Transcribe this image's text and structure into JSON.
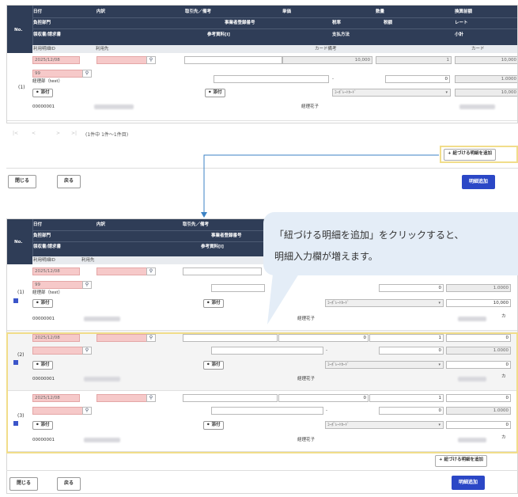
{
  "header": {
    "no": "No.",
    "row1": [
      "日付",
      "内訳",
      "取引先／備考",
      "単価",
      "数量",
      "換算前額"
    ],
    "row2": [
      "負担部門",
      "事業者登録番号",
      "税率",
      "税額",
      "レート"
    ],
    "row3": [
      "領収書/請求書",
      "参考資料[i]",
      "支払方法",
      "小計"
    ],
    "sub": [
      "利用明細ID",
      "利用先",
      "カード備考",
      "カード"
    ]
  },
  "record": {
    "date": "2025/12/08",
    "dept_code": "99",
    "dept_name": "経理部（test）",
    "attach": "添付",
    "payment": "ｺｰﾎﾟﾚｰﾄｶｰﾄﾞ",
    "detail_id": "00000001",
    "approver": "経理花子",
    "dash": "-",
    "card_suffix": "カ"
  },
  "top": {
    "row_label": "(1)",
    "unit_price": "10,000",
    "quantity": "1",
    "amount": "10,000",
    "tax": "0",
    "rate": "1.0000",
    "subtotal": "10,000",
    "pagination_first": "|<",
    "pagination_prev": "<",
    "pagination_next": ">",
    "pagination_last": ">|",
    "pagination_info": "(1件中 1件～1件目)"
  },
  "bottom_rows": [
    {
      "label": "(1)",
      "tax": "0",
      "rate": "1.0000",
      "subtotal": "10,000"
    },
    {
      "label": "(2)",
      "unit_price": "0",
      "quantity": "1",
      "amount": "0",
      "tax": "0",
      "rate": "1.0000",
      "subtotal": "0"
    },
    {
      "label": "(3)",
      "unit_price": "0",
      "quantity": "1",
      "amount": "0",
      "tax": "0",
      "rate": "1.0000",
      "subtotal": "0"
    }
  ],
  "buttons": {
    "add_detail": "紐づける明細を追加",
    "close": "閉じる",
    "back": "戻る",
    "add_line": "明細追加"
  },
  "callout": {
    "line1": "「紐づける明細を追加」をクリックすると、",
    "line2": "明細入力欄が増えます。"
  },
  "colors": {
    "header_bg": "#2f3d57",
    "primary": "#2b47c6",
    "highlight": "#f1dd8a",
    "arrow": "#3b82c4"
  },
  "icons": [
    "search-icon",
    "paperclip-icon",
    "plus-icon",
    "chevron-down-icon",
    "row-handle-icon"
  ]
}
